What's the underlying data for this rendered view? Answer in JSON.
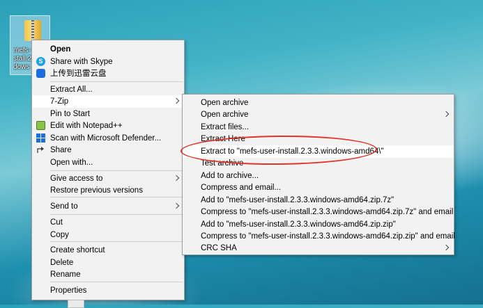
{
  "desktop": {
    "icon_label": "mefs-\nstall.2\ndows"
  },
  "context_menu": {
    "items": [
      {
        "label": "Open",
        "bold": true
      },
      {
        "label": "Share with Skype",
        "icon": "skype-icon"
      },
      {
        "label": "上传到迅雷云盘",
        "icon": "xunlei-cloud-icon"
      },
      {
        "label": "Extract All..."
      },
      {
        "label": "7-Zip",
        "submenu": true
      },
      {
        "label": "Pin to Start"
      },
      {
        "label": "Edit with Notepad++",
        "icon": "notepadpp-icon"
      },
      {
        "label": "Scan with Microsoft Defender...",
        "icon": "defender-shield-icon"
      },
      {
        "label": "Share",
        "icon": "share-icon"
      },
      {
        "label": "Open with..."
      },
      {
        "label": "Give access to",
        "submenu": true
      },
      {
        "label": "Restore previous versions"
      },
      {
        "label": "Send to",
        "submenu": true
      },
      {
        "label": "Cut"
      },
      {
        "label": "Copy"
      },
      {
        "label": "Create shortcut"
      },
      {
        "label": "Delete"
      },
      {
        "label": "Rename"
      },
      {
        "label": "Properties"
      }
    ]
  },
  "sevenzip_menu": {
    "items": [
      {
        "label": "Open archive"
      },
      {
        "label": "Open archive",
        "submenu": true
      },
      {
        "label": "Extract files..."
      },
      {
        "label": "Extract Here"
      },
      {
        "label": "Extract to \"mefs-user-install.2.3.3.windows-amd64\\\"",
        "highlighted": true
      },
      {
        "label": "Test archive"
      },
      {
        "label": "Add to archive..."
      },
      {
        "label": "Compress and email..."
      },
      {
        "label": "Add to \"mefs-user-install.2.3.3.windows-amd64.zip.7z\""
      },
      {
        "label": "Compress to \"mefs-user-install.2.3.3.windows-amd64.zip.7z\" and email"
      },
      {
        "label": "Add to \"mefs-user-install.2.3.3.windows-amd64.zip.zip\""
      },
      {
        "label": "Compress to \"mefs-user-install.2.3.3.windows-amd64.zip.zip\" and email"
      },
      {
        "label": "CRC SHA",
        "submenu": true
      }
    ]
  },
  "annotation": {
    "highlight_color": "#e0332a"
  }
}
